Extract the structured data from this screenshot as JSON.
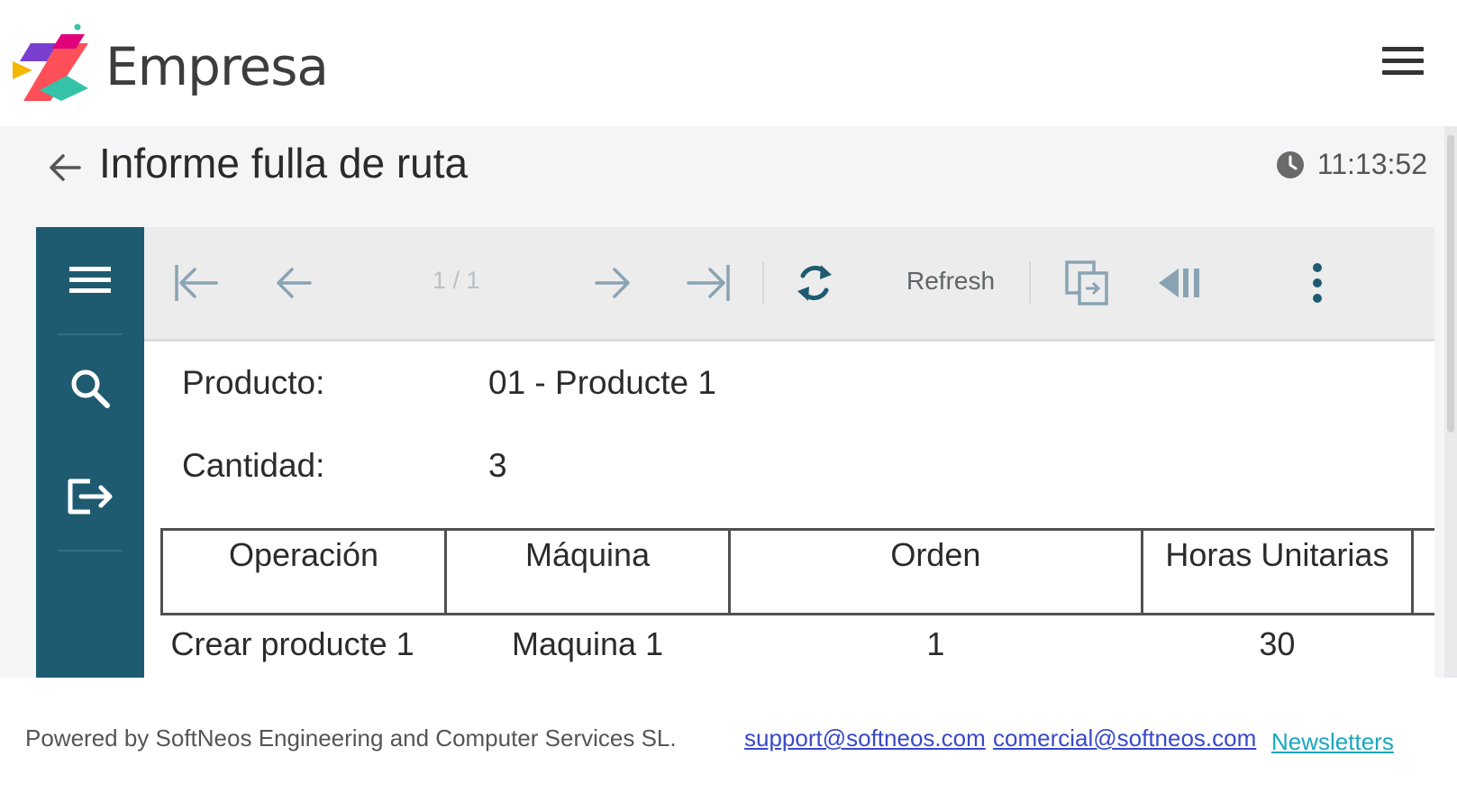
{
  "header": {
    "brand": "Empresa",
    "logo_colors": [
      "#f5b800",
      "#e0007a",
      "#ff5c3b",
      "#34c3a8",
      "#7b3fd0"
    ]
  },
  "page": {
    "title": "Informe fulla de ruta",
    "time": "11:13:52"
  },
  "sidebar": {
    "items": [
      {
        "icon": "menu-icon"
      },
      {
        "icon": "search-icon"
      },
      {
        "icon": "logout-icon"
      }
    ],
    "color": "#1e5b71"
  },
  "toolbar": {
    "page_indicator": "1 / 1",
    "refresh_label": "Refresh",
    "buttons": [
      "first-page-icon",
      "previous-page-icon",
      "next-page-icon",
      "last-page-icon",
      "refresh-icon",
      "export-icon",
      "toggle-sidebar-icon",
      "more-options-icon"
    ]
  },
  "report": {
    "product_label": "Producto:",
    "product_value": "01 - Producte 1",
    "quantity_label": "Cantidad:",
    "quantity_value": "3",
    "columns": [
      "Operación",
      "Máquina",
      "Orden",
      "Horas Unitarias"
    ],
    "rows": [
      [
        "Crear producte 1",
        "Maquina 1",
        "1",
        "30"
      ]
    ]
  },
  "footer": {
    "powered": "Powered by SoftNeos Engineering and Computer Services SL.",
    "support_email": "support@softneos.com",
    "commercial_email": "comercial@softneos.com",
    "newsletters": "Newsletters"
  }
}
